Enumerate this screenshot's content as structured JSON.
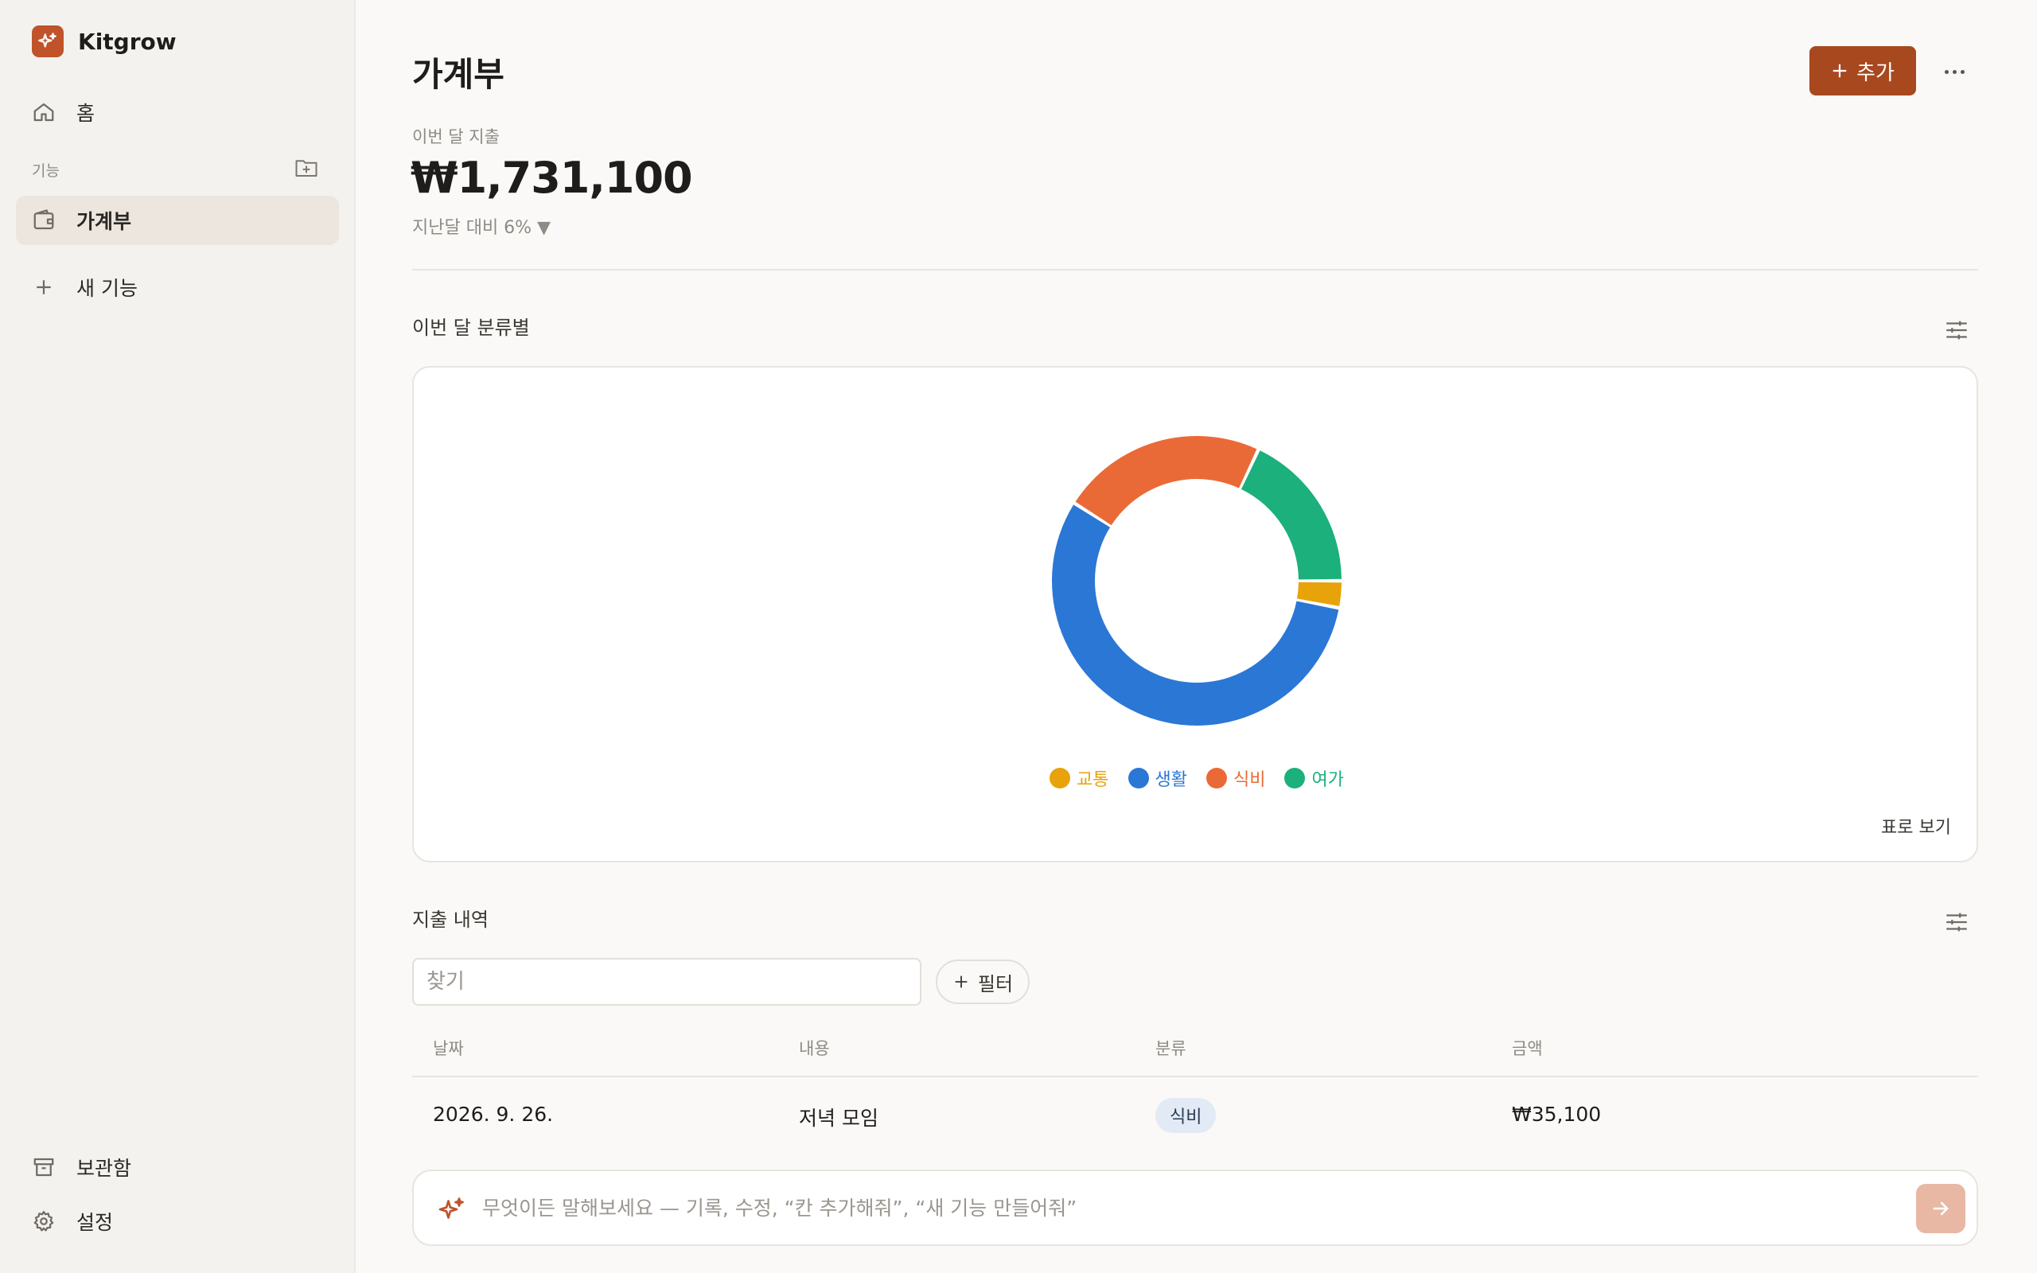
{
  "app": {
    "name": "Kitgrow"
  },
  "sidebar": {
    "home_label": "홈",
    "section_label": "기능",
    "items": [
      {
        "label": "가계부",
        "active": true
      }
    ],
    "new_feature_label": "새 기능",
    "archive_label": "보관함",
    "settings_label": "설정"
  },
  "page": {
    "title": "가계부",
    "add_label": "추가"
  },
  "summary": {
    "label": "이번 달 지출",
    "value": "₩1,731,100",
    "compare": "지난달 대비 6% ▼"
  },
  "category_section": {
    "title": "이번 달 분류별",
    "table_view_label": "표로 보기"
  },
  "chart_data": {
    "type": "pie",
    "donut": true,
    "categories": [
      "교통",
      "생활",
      "식비",
      "여가"
    ],
    "values": [
      3,
      56,
      23,
      18
    ],
    "colors": [
      "#e8a20a",
      "#2b77d5",
      "#ea6a37",
      "#1bb07c"
    ],
    "legend": "bottom"
  },
  "expenses": {
    "title": "지출 내역",
    "search_placeholder": "찾기",
    "filter_label": "필터",
    "columns": [
      "날짜",
      "내용",
      "분류",
      "금액"
    ],
    "rows": [
      {
        "date": "2026. 9. 26.",
        "content": "저녁 모임",
        "category": "식비",
        "amount": "₩35,100"
      }
    ]
  },
  "chat": {
    "placeholder": "무엇이든 말해보세요 — 기록, 수정, “칸 추가해줘”, “새 기능 만들어줘”"
  },
  "colors": {
    "accent": "#a8481f",
    "logo": "#c0532a",
    "send": "#e8b8a4"
  }
}
